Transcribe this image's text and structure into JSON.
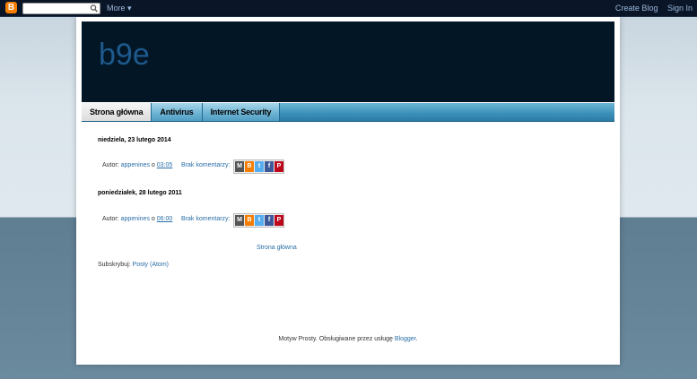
{
  "navbar": {
    "logo_letter": "B",
    "search_value": "",
    "more_label": "More ▾",
    "create_blog": "Create Blog",
    "sign_in": "Sign In"
  },
  "header": {
    "title": "b9e"
  },
  "tabs": [
    {
      "label": "Strona główna",
      "selected": true
    },
    {
      "label": "Antivirus",
      "selected": false
    },
    {
      "label": "Internet Security",
      "selected": false
    }
  ],
  "posts": [
    {
      "date": "niedziela, 23 lutego 2014",
      "author_prefix": "Autor:",
      "author": "appenines",
      "time_prefix": "o",
      "time": "03:05",
      "comments": "Brak komentarzy:"
    },
    {
      "date": "poniedziałek, 28 lutego 2011",
      "author_prefix": "Autor:",
      "author": "appenines",
      "time_prefix": "o",
      "time": "06:00",
      "comments": "Brak komentarzy:"
    }
  ],
  "share_icons": [
    "email-icon",
    "blogthis-icon",
    "twitter-icon",
    "facebook-icon",
    "pinterest-icon"
  ],
  "home_link": "Strona główna",
  "subscribe": {
    "label": "Subskrybuj:",
    "link": "Posty (Atom)"
  },
  "attribution": {
    "text": "Motyw Prosty. Obsługiwane przez usługę",
    "link": "Blogger",
    "suffix": "."
  },
  "colors": {
    "header_bg": "#021626",
    "title": "#1e5a8d",
    "link": "#2a6ea8",
    "tab_bar": "#3a8fb8"
  }
}
